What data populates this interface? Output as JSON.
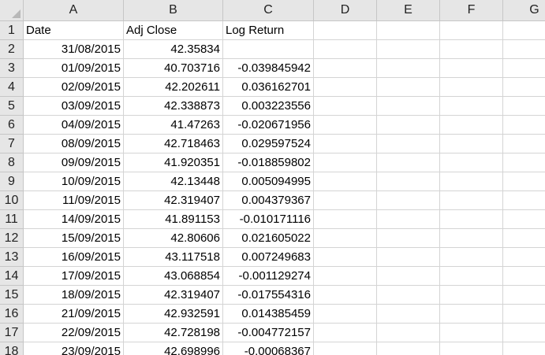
{
  "columns": [
    "A",
    "B",
    "C",
    "D",
    "E",
    "F",
    "G"
  ],
  "rows": [
    {
      "num": "1",
      "a": "Date",
      "b": "Adj Close",
      "c": "Log Return"
    },
    {
      "num": "2",
      "a": "31/08/2015",
      "b": "42.35834",
      "c": ""
    },
    {
      "num": "3",
      "a": "01/09/2015",
      "b": "40.703716",
      "c": "-0.039845942"
    },
    {
      "num": "4",
      "a": "02/09/2015",
      "b": "42.202611",
      "c": "0.036162701"
    },
    {
      "num": "5",
      "a": "03/09/2015",
      "b": "42.338873",
      "c": "0.003223556"
    },
    {
      "num": "6",
      "a": "04/09/2015",
      "b": "41.47263",
      "c": "-0.020671956"
    },
    {
      "num": "7",
      "a": "08/09/2015",
      "b": "42.718463",
      "c": "0.029597524"
    },
    {
      "num": "8",
      "a": "09/09/2015",
      "b": "41.920351",
      "c": "-0.018859802"
    },
    {
      "num": "9",
      "a": "10/09/2015",
      "b": "42.13448",
      "c": "0.005094995"
    },
    {
      "num": "10",
      "a": "11/09/2015",
      "b": "42.319407",
      "c": "0.004379367"
    },
    {
      "num": "11",
      "a": "14/09/2015",
      "b": "41.891153",
      "c": "-0.010171116"
    },
    {
      "num": "12",
      "a": "15/09/2015",
      "b": "42.80606",
      "c": "0.021605022"
    },
    {
      "num": "13",
      "a": "16/09/2015",
      "b": "43.117518",
      "c": "0.007249683"
    },
    {
      "num": "14",
      "a": "17/09/2015",
      "b": "43.068854",
      "c": "-0.001129274"
    },
    {
      "num": "15",
      "a": "18/09/2015",
      "b": "42.319407",
      "c": "-0.017554316"
    },
    {
      "num": "16",
      "a": "21/09/2015",
      "b": "42.932591",
      "c": "0.014385459"
    },
    {
      "num": "17",
      "a": "22/09/2015",
      "b": "42.728198",
      "c": "-0.004772157"
    },
    {
      "num": "18",
      "a": "23/09/2015",
      "b": "42.698996",
      "c": "-0.00068367"
    }
  ]
}
